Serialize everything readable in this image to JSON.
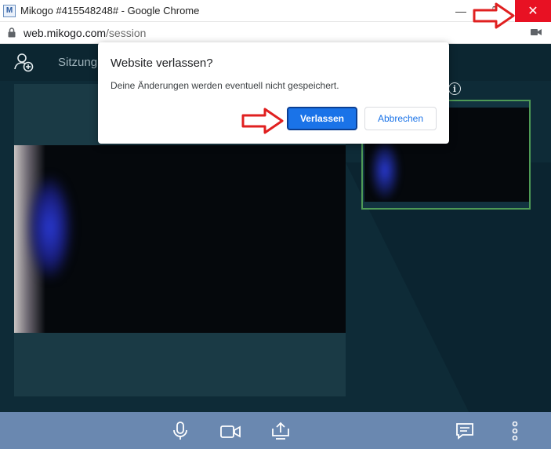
{
  "window": {
    "title": "Mikogo #415548248# - Google Chrome",
    "favicon_text": "M",
    "minimize_glyph": "—",
    "restore_glyph": "❐",
    "close_glyph": "✕"
  },
  "address": {
    "host": "web.mikogo.com",
    "path": "/session"
  },
  "app": {
    "session_label": "Sitzung",
    "info_glyph": "i"
  },
  "dialog": {
    "title": "Website verlassen?",
    "message": "Deine Änderungen werden eventuell nicht gespeichert.",
    "leave_label": "Verlassen",
    "cancel_label": "Abbrechen"
  },
  "colors": {
    "accent": "#1a73e8",
    "close_red": "#e81123",
    "arrow_red": "#e02020",
    "toolbar_blue": "#6a88b0",
    "thumb_border": "#4e9a56"
  },
  "icons": [
    "lock-icon",
    "camera-icon",
    "add-user-icon",
    "info-icon",
    "microphone-icon",
    "video-camera-icon",
    "share-screen-icon",
    "chat-icon",
    "more-vertical-icon"
  ]
}
